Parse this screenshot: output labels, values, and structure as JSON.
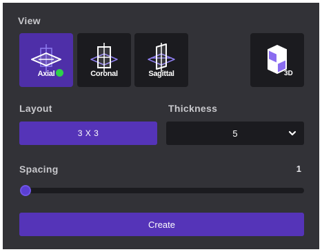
{
  "view": {
    "label": "View",
    "buttons": [
      {
        "label": "Axial",
        "icon": "axial-plane-icon",
        "active": true
      },
      {
        "label": "Coronal",
        "icon": "coronal-plane-icon",
        "active": false
      },
      {
        "label": "Sagittal",
        "icon": "sagittal-plane-icon",
        "active": false
      }
    ],
    "three_d": {
      "icon": "cube-3d-icon",
      "label": "3D"
    }
  },
  "layout": {
    "label": "Layout",
    "value": "3 X 3"
  },
  "thickness": {
    "label": "Thickness",
    "value": "5"
  },
  "spacing": {
    "label": "Spacing",
    "value": "1",
    "slider_position": 0
  },
  "create": {
    "label": "Create"
  },
  "colors": {
    "panel_bg": "#323237",
    "button_bg": "#1b1b1f",
    "accent": "#5534b8",
    "active_indicator": "#2dd24a"
  }
}
